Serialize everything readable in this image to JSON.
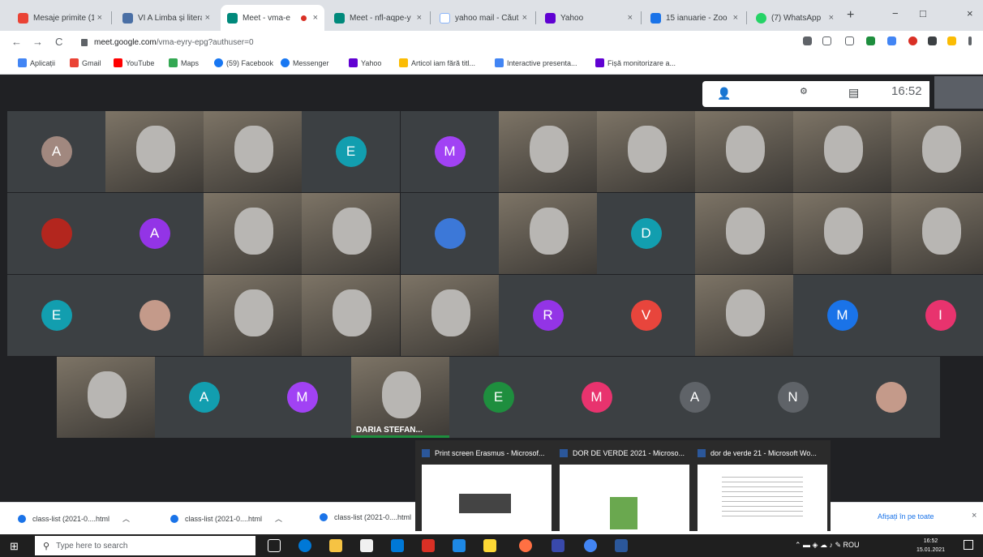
{
  "tabs": [
    {
      "label": "Mesaje primite (1)",
      "close": "×",
      "color": "#ea4335"
    },
    {
      "label": "VI A Limba și litera",
      "close": "×",
      "color": "#4a6fa5"
    },
    {
      "label": "Meet - vma-e",
      "close": "×",
      "color": "#00897b"
    },
    {
      "label": "Meet - nfl-aqpe-y",
      "close": "×",
      "color": "#00897b"
    },
    {
      "label": "yahoo mail - Căut",
      "close": "×",
      "color": "#8ab4f8"
    },
    {
      "label": "Yahoo",
      "close": "×",
      "color": "#6001d2"
    },
    {
      "label": "15 ianuarie - Zoo",
      "close": "×",
      "color": "#1a73e8"
    },
    {
      "label": "(7) WhatsApp",
      "close": "×",
      "color": "#25d366"
    }
  ],
  "browser": {
    "new_tab": "+",
    "minimize": "−",
    "maximize": "□",
    "close": "×",
    "back": "←",
    "forward": "→",
    "reload": "C"
  },
  "address": {
    "host": "meet.google.com",
    "path": "/vma-eyry-epg?authuser=0"
  },
  "bookmarks": [
    {
      "label": "Aplicații",
      "color": "#4285f4"
    },
    {
      "label": "Gmail",
      "color": "#ea4335"
    },
    {
      "label": "YouTube",
      "color": "#ff0000"
    },
    {
      "label": "Maps",
      "color": "#34a853"
    },
    {
      "label": "(59) Facebook",
      "color": "#1877f2"
    },
    {
      "label": "Messenger",
      "color": "#1877f2"
    },
    {
      "label": "Yahoo",
      "color": "#6001d2"
    },
    {
      "label": "Articol iam fără titl...",
      "color": "#fbbc04"
    },
    {
      "label": "Interactive presenta...",
      "color": "#4285f4"
    },
    {
      "label": "Fișă monitorizare a...",
      "color": "#6001d2"
    }
  ],
  "meet": {
    "time": "16:52",
    "participants_icon": "people-icon",
    "chat_icon": "chat-icon",
    "activities_icon": "activities-icon",
    "tiles": [
      {
        "type": "avatar",
        "letter": "A",
        "color": "#a1887f"
      },
      {
        "type": "video"
      },
      {
        "type": "video"
      },
      {
        "type": "avatar",
        "letter": "E",
        "color": "#129eaf"
      },
      {
        "type": "avatar",
        "letter": "M",
        "color": "#a142f4"
      },
      {
        "type": "video"
      },
      {
        "type": "video"
      },
      {
        "type": "video"
      },
      {
        "type": "video"
      },
      {
        "type": "video"
      },
      {
        "type": "avatar",
        "letter": "",
        "color": "#b3261e"
      },
      {
        "type": "avatar",
        "letter": "A",
        "color": "#9334e6"
      },
      {
        "type": "video"
      },
      {
        "type": "video"
      },
      {
        "type": "avatar",
        "letter": "",
        "color": "#3c78d8"
      },
      {
        "type": "video"
      },
      {
        "type": "avatar",
        "letter": "D",
        "color": "#129eaf"
      },
      {
        "type": "video"
      },
      {
        "type": "video"
      },
      {
        "type": "video"
      },
      {
        "type": "avatar",
        "letter": "E",
        "color": "#129eaf"
      },
      {
        "type": "avatar",
        "letter": "",
        "color": "#c49a8a"
      },
      {
        "type": "video"
      },
      {
        "type": "video"
      },
      {
        "type": "video"
      },
      {
        "type": "avatar",
        "letter": "R",
        "color": "#9334e6"
      },
      {
        "type": "avatar",
        "letter": "V",
        "color": "#e8453c"
      },
      {
        "type": "video"
      },
      {
        "type": "avatar",
        "letter": "M",
        "color": "#1a73e8"
      },
      {
        "type": "avatar",
        "letter": "I",
        "color": "#e8336e"
      },
      {
        "type": "video"
      },
      {
        "type": "avatar",
        "letter": "A",
        "color": "#129eaf"
      },
      {
        "type": "avatar",
        "letter": "M",
        "color": "#a142f4"
      },
      {
        "type": "video",
        "name": "DARIA STEFAN..."
      },
      {
        "type": "avatar",
        "letter": "E",
        "color": "#1e8e3e"
      },
      {
        "type": "avatar",
        "letter": "M",
        "color": "#e8336e"
      },
      {
        "type": "avatar",
        "letter": "A",
        "color": "#5f6368"
      },
      {
        "type": "avatar",
        "letter": "N",
        "color": "#5f6368"
      },
      {
        "type": "avatar",
        "letter": "",
        "color": "#c49a8a"
      }
    ]
  },
  "popup": [
    {
      "title": "Print screen Erasmus - Microsof..."
    },
    {
      "title": "DOR DE VERDE 2021 - Microso..."
    },
    {
      "title": "dor de verde 21 - Microsoft Wo..."
    }
  ],
  "downloads": {
    "items": [
      {
        "label": "class-list (2021-0....html"
      },
      {
        "label": "class-list (2021-0....html"
      },
      {
        "label": "class-list (2021-0....html"
      }
    ],
    "show_all": "Afișați în pe toate",
    "close": "×"
  },
  "taskbar": {
    "search_placeholder": "Type here to search",
    "language": "ROU",
    "clock_time": "16:52",
    "clock_date": "15.01.2021"
  }
}
